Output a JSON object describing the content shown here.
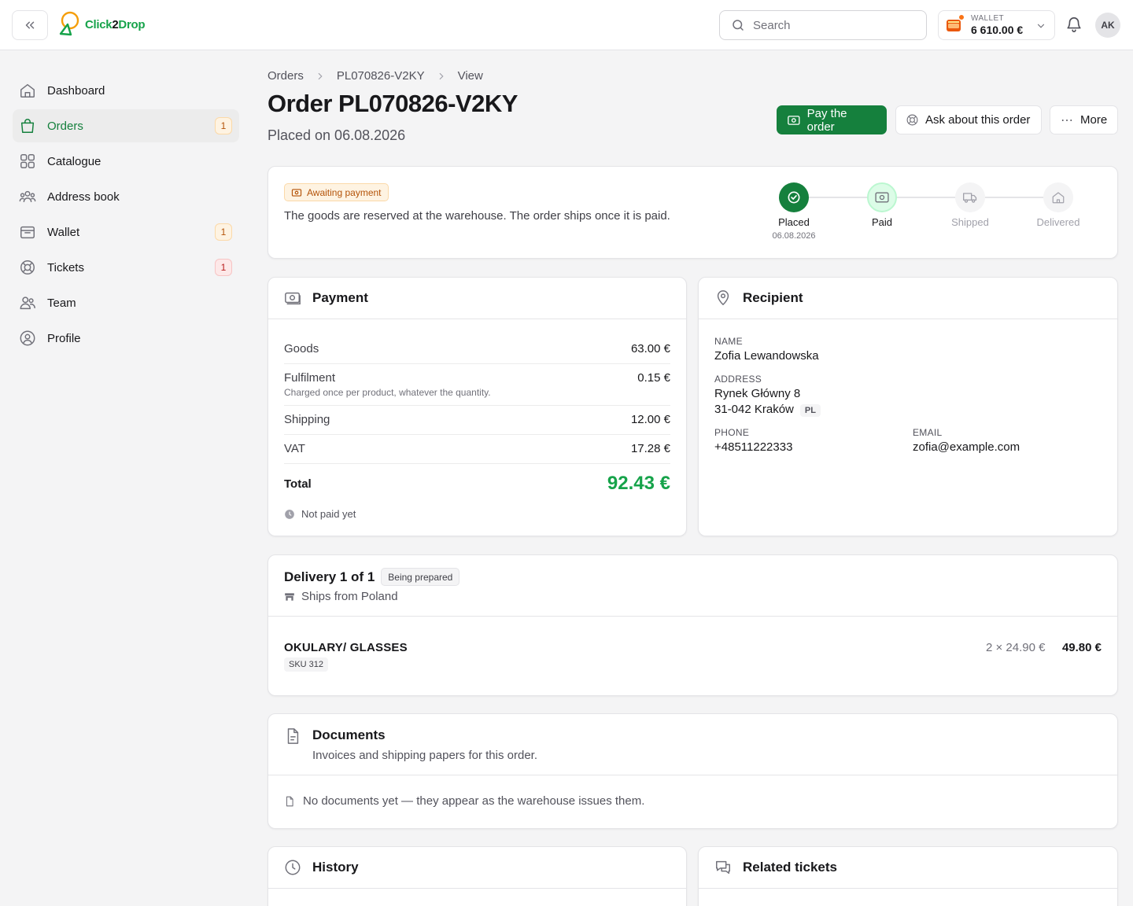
{
  "header": {
    "logo_text_a": "Click",
    "logo_text_b": "2",
    "logo_text_c": "Drop",
    "search_placeholder": "Search",
    "wallet_label": "WALLET",
    "wallet_amount": "6 610.00 €",
    "avatar_initials": "AK"
  },
  "sidebar": {
    "items": [
      {
        "label": "Dashboard",
        "icon": "home-icon"
      },
      {
        "label": "Orders",
        "icon": "shopping-bag-icon",
        "badge": "1"
      },
      {
        "label": "Catalogue",
        "icon": "grid-icon"
      },
      {
        "label": "Address book",
        "icon": "users-group-icon"
      },
      {
        "label": "Wallet",
        "icon": "wallet-icon",
        "badge": "1"
      },
      {
        "label": "Tickets",
        "icon": "lifebuoy-icon",
        "badge": "1"
      },
      {
        "label": "Team",
        "icon": "team-icon"
      },
      {
        "label": "Profile",
        "icon": "user-circle-icon"
      }
    ]
  },
  "breadcrumb": [
    "Orders",
    "PL070826-V2KY",
    "View"
  ],
  "page": {
    "title": "Order PL070826-V2KY",
    "subtitle": "Placed on 06.08.2026"
  },
  "actions": {
    "pay": "Pay the order",
    "ask": "Ask about this order",
    "more": "More"
  },
  "status": {
    "badge": "Awaiting payment",
    "text": "The goods are reserved at the warehouse. The order ships once it is paid.",
    "steps": [
      {
        "label": "Placed",
        "date": "06.08.2026",
        "state": "done"
      },
      {
        "label": "Paid",
        "date": "",
        "state": "current"
      },
      {
        "label": "Shipped",
        "date": "",
        "state": "todo"
      },
      {
        "label": "Delivered",
        "date": "",
        "state": "todo"
      }
    ]
  },
  "payment": {
    "title": "Payment",
    "rows": [
      {
        "label": "Goods",
        "value": "63.00 €",
        "note": ""
      },
      {
        "label": "Fulfilment",
        "value": "0.15 €",
        "note": "Charged once per product, whatever the quantity."
      },
      {
        "label": "Shipping",
        "value": "12.00 €",
        "note": ""
      },
      {
        "label": "VAT",
        "value": "17.28 €",
        "note": ""
      }
    ],
    "total_label": "Total",
    "total_value": "92.43 €",
    "status": "Not paid yet"
  },
  "recipient": {
    "title": "Recipient",
    "name_label": "NAME",
    "name": "Zofia Lewandowska",
    "address_label": "ADDRESS",
    "address_line1": "Rynek Główny 8",
    "address_line2": "31-042 Kraków",
    "country": "PL",
    "phone_label": "PHONE",
    "phone": "+48511222333",
    "email_label": "EMAIL",
    "email": "zofia@example.com"
  },
  "delivery": {
    "title": "Delivery 1 of 1",
    "status": "Being prepared",
    "origin": "Ships from Poland",
    "item": {
      "name": "OKULARY/ GLASSES",
      "sku": "SKU 312",
      "qty_price": "2 × 24.90 €",
      "total": "49.80 €"
    }
  },
  "documents": {
    "title": "Documents",
    "subtitle": "Invoices and shipping papers for this order.",
    "empty": "No documents yet — they appear as the warehouse issues them."
  },
  "history": {
    "title": "History"
  },
  "tickets": {
    "title": "Related tickets"
  },
  "colors": {
    "brand_green": "#15803d",
    "accent_orange": "#f97316",
    "total_green": "#16a34a"
  }
}
